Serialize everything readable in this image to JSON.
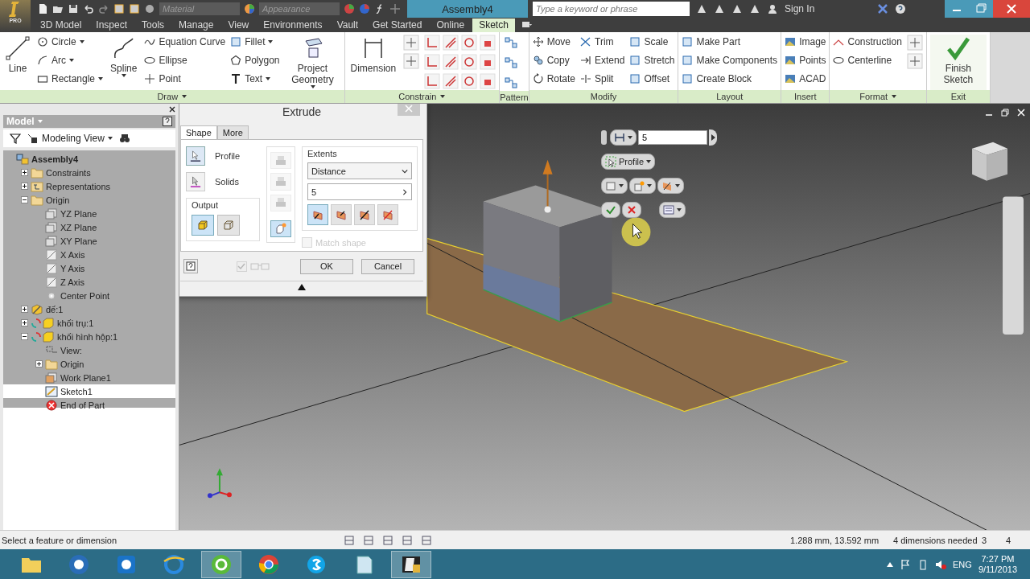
{
  "title_bar": {
    "app_badge": "PRO",
    "material": "Material",
    "appearance": "Appearance",
    "title": "Assembly4",
    "search_placeholder": "Type a keyword or phrase",
    "sign_in": "Sign In"
  },
  "tabs": [
    {
      "label": "3D Model",
      "selected": false
    },
    {
      "label": "Inspect",
      "selected": false
    },
    {
      "label": "Tools",
      "selected": false
    },
    {
      "label": "Manage",
      "selected": false
    },
    {
      "label": "View",
      "selected": false
    },
    {
      "label": "Environments",
      "selected": false
    },
    {
      "label": "Vault",
      "selected": false
    },
    {
      "label": "Get Started",
      "selected": false
    },
    {
      "label": "Online",
      "selected": false
    },
    {
      "label": "Sketch",
      "selected": true
    }
  ],
  "ribbon": [
    {
      "label": "Draw",
      "menu": true,
      "columns": [
        {
          "kind": "large",
          "label": "Line",
          "dropdown": false
        },
        {
          "kind": "stack",
          "items": [
            {
              "label": "Circle",
              "dropdown": true
            },
            {
              "label": "Arc",
              "dropdown": true
            },
            {
              "label": "Rectangle",
              "dropdown": true
            }
          ]
        },
        {
          "kind": "large",
          "label": "Spline",
          "dropdown": true
        },
        {
          "kind": "stack",
          "items": [
            {
              "label": "Equation Curve",
              "dropdown": false
            },
            {
              "label": "Ellipse",
              "dropdown": false
            },
            {
              "label": "Point",
              "dropdown": false
            }
          ]
        },
        {
          "kind": "stack",
          "items": [
            {
              "label": "Fillet",
              "dropdown": true
            },
            {
              "label": "Polygon",
              "dropdown": false
            },
            {
              "label": "Text",
              "dropdown": true
            }
          ]
        },
        {
          "kind": "large",
          "label": "Project Geometry",
          "dropdown": true
        }
      ]
    },
    {
      "label": "Constrain",
      "menu": true,
      "columns": [
        {
          "kind": "large",
          "label": "Dimension",
          "dropdown": false
        },
        {
          "kind": "icon-pair"
        },
        {
          "kind": "constraint-grid"
        }
      ]
    },
    {
      "label": "Pattern",
      "menu": false,
      "columns": [
        {
          "kind": "icon-stack"
        }
      ]
    },
    {
      "label": "Modify",
      "menu": false,
      "columns": [
        {
          "kind": "stack",
          "items": [
            {
              "label": "Move",
              "dropdown": false
            },
            {
              "label": "Copy",
              "dropdown": false
            },
            {
              "label": "Rotate",
              "dropdown": false
            }
          ]
        },
        {
          "kind": "stack",
          "items": [
            {
              "label": "Trim",
              "dropdown": false
            },
            {
              "label": "Extend",
              "dropdown": false
            },
            {
              "label": "Split",
              "dropdown": false
            }
          ]
        },
        {
          "kind": "stack",
          "items": [
            {
              "label": "Scale",
              "dropdown": false
            },
            {
              "label": "Stretch",
              "dropdown": false
            },
            {
              "label": "Offset",
              "dropdown": false
            }
          ]
        }
      ]
    },
    {
      "label": "Layout",
      "menu": false,
      "columns": [
        {
          "kind": "stack",
          "items": [
            {
              "label": "Make Part",
              "dropdown": false
            },
            {
              "label": "Make Components",
              "dropdown": false
            },
            {
              "label": "Create Block",
              "dropdown": false
            }
          ]
        }
      ]
    },
    {
      "label": "Insert",
      "menu": false,
      "columns": [
        {
          "kind": "stack",
          "items": [
            {
              "label": "Image",
              "dropdown": false
            },
            {
              "label": "Points",
              "dropdown": false
            },
            {
              "label": "ACAD",
              "dropdown": false
            }
          ]
        }
      ]
    },
    {
      "label": "Format",
      "menu": true,
      "columns": [
        {
          "kind": "stack",
          "items": [
            {
              "label": "Construction",
              "dropdown": false
            },
            {
              "label": "Centerline",
              "dropdown": false
            }
          ]
        },
        {
          "kind": "icon-pair"
        }
      ]
    },
    {
      "label": "Exit",
      "menu": false,
      "columns": [
        {
          "kind": "finish",
          "label": "Finish Sketch"
        }
      ]
    }
  ],
  "browser": {
    "title": "Model",
    "view": "Modeling View",
    "tree": {
      "label": "Assembly4",
      "kind": "assembly",
      "selected": false,
      "children": [
        {
          "label": "Constraints",
          "kind": "folder",
          "expanded": false,
          "selected": false
        },
        {
          "label": "Representations",
          "kind": "representations",
          "expanded": false,
          "selected": false
        },
        {
          "label": "Origin",
          "kind": "folder-open",
          "expanded": true,
          "selected": false,
          "children": [
            {
              "label": "YZ Plane",
              "kind": "plane",
              "selected": false
            },
            {
              "label": "XZ Plane",
              "kind": "plane",
              "selected": false
            },
            {
              "label": "XY Plane",
              "kind": "plane",
              "selected": false
            },
            {
              "label": "X Axis",
              "kind": "axis",
              "selected": false
            },
            {
              "label": "Y Axis",
              "kind": "axis",
              "selected": false
            },
            {
              "label": "Z Axis",
              "kind": "axis",
              "selected": false
            },
            {
              "label": "Center Point",
              "kind": "point",
              "selected": false
            }
          ]
        },
        {
          "label": "đế:1",
          "kind": "grounded-part",
          "expanded": false,
          "selected": false
        },
        {
          "label": "khối trụ:1",
          "kind": "part-update",
          "expanded": false,
          "selected": false
        },
        {
          "label": "khối hình hộp:1",
          "kind": "part-update",
          "expanded": true,
          "selected": false,
          "children": [
            {
              "label": "View:",
              "kind": "view",
              "selected": false
            },
            {
              "label": "Origin",
              "kind": "folder",
              "expanded": false,
              "selected": false
            },
            {
              "label": "Work Plane1",
              "kind": "workplane",
              "selected": false
            },
            {
              "label": "Sketch1",
              "kind": "sketch",
              "selected": true
            },
            {
              "label": "End of Part",
              "kind": "end",
              "selected": false
            }
          ]
        }
      ]
    }
  },
  "mini_toolbar": {
    "value": "5",
    "profile": "Profile"
  },
  "dialog": {
    "title": "Extrude",
    "tabs": [
      {
        "label": "Shape",
        "selected": true
      },
      {
        "label": "More",
        "selected": false
      }
    ],
    "selectors": [
      {
        "label": "Profile",
        "selected": true
      },
      {
        "label": "Solids",
        "selected": false
      }
    ],
    "output": {
      "label": "Output",
      "options": [
        {
          "selected": true
        },
        {
          "selected": false
        }
      ]
    },
    "operations": [
      {
        "disabled": true,
        "selected": false
      },
      {
        "disabled": true,
        "selected": false
      },
      {
        "disabled": true,
        "selected": false
      },
      {
        "disabled": false,
        "selected": true
      }
    ],
    "extents": {
      "label": "Extents",
      "type": "Distance",
      "value": "5",
      "directions": [
        {
          "selected": true
        },
        {
          "selected": false
        },
        {
          "selected": false
        },
        {
          "selected": false
        }
      ]
    },
    "match_shape": {
      "label": "Match shape",
      "checked": false,
      "disabled": true
    },
    "preview": {
      "checked": true,
      "disabled": true
    },
    "buttons": [
      "OK",
      "Cancel"
    ]
  },
  "status_bar": {
    "prompt": "Select a feature or dimension",
    "coords": "1.288 mm, 13.592 mm",
    "dimensions": "4 dimensions needed",
    "count_1": "3",
    "count_2": "4"
  },
  "taskbar": {
    "apps": [
      {
        "kind": "folder",
        "active": false
      },
      {
        "kind": "media",
        "active": false
      },
      {
        "kind": "remote",
        "active": false
      },
      {
        "kind": "browser-e",
        "active": false
      },
      {
        "kind": "green-app",
        "active": true
      },
      {
        "kind": "browser-ball",
        "active": false
      },
      {
        "kind": "chat",
        "active": false
      },
      {
        "kind": "note",
        "active": false
      },
      {
        "kind": "cad",
        "active": true
      }
    ],
    "lang": "ENG",
    "time": "7:27 PM",
    "date": "9/11/2013"
  }
}
